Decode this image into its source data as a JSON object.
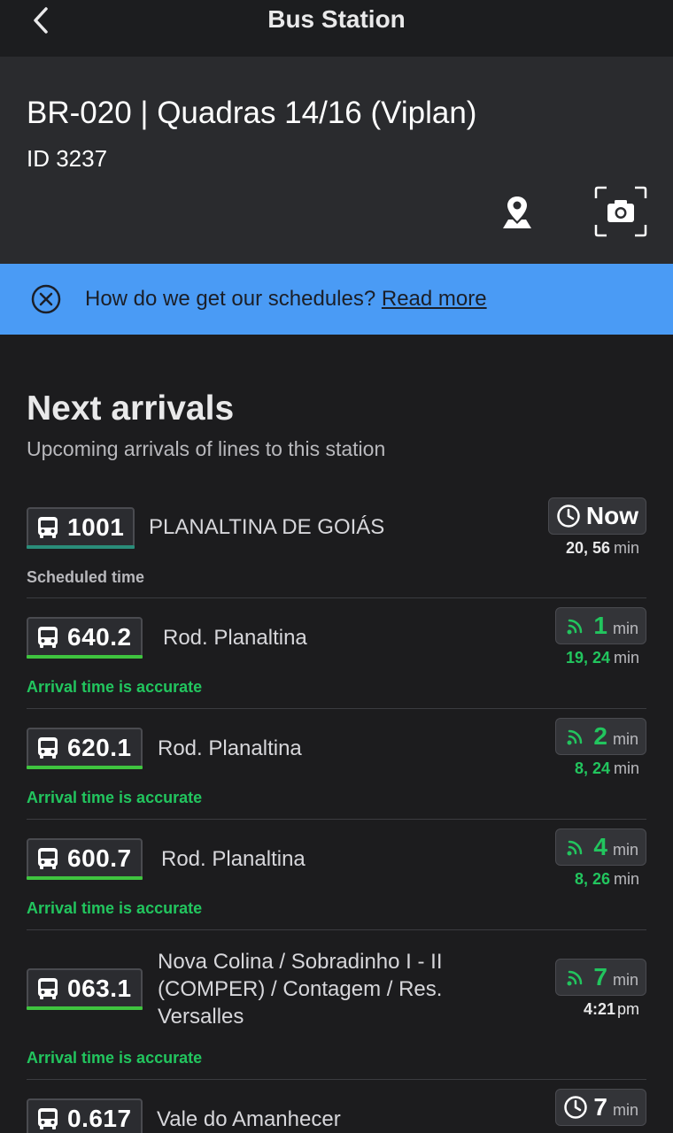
{
  "topbar": {
    "title": "Bus Station",
    "back_icon": "chevron-left-icon"
  },
  "station": {
    "name": "BR-020 | Quadras 14/16 (Viplan)",
    "id_text": "ID 3237",
    "map_icon": "map-pin-icon",
    "camera_icon": "camera-icon"
  },
  "banner": {
    "text": "How do we get our schedules?",
    "link": "Read more",
    "close_icon": "close-circle-icon",
    "color": "#4a9bf5"
  },
  "section": {
    "title": "Next arrivals",
    "subtitle": "Upcoming arrivals of lines to this station"
  },
  "arrivals": [
    {
      "line": "1001",
      "destination": "PLANALTINA DE GOIÁS",
      "eta": "Now",
      "eta_unit": "",
      "eta_icon": "clock-icon",
      "next": "20, 56",
      "next_unit": "min",
      "note": "Scheduled time",
      "realtime": false
    },
    {
      "line": "640.2",
      "destination": "Rod. Planaltina",
      "eta": "1",
      "eta_unit": "min",
      "eta_icon": "realtime-signal-icon",
      "next": "19, 24",
      "next_unit": "min",
      "note": "Arrival time is accurate",
      "realtime": true
    },
    {
      "line": "620.1",
      "destination": "Rod. Planaltina",
      "eta": "2",
      "eta_unit": "min",
      "eta_icon": "realtime-signal-icon",
      "next": "8, 24",
      "next_unit": "min",
      "note": "Arrival time is accurate",
      "realtime": true
    },
    {
      "line": "600.7",
      "destination": "Rod. Planaltina",
      "eta": "4",
      "eta_unit": "min",
      "eta_icon": "realtime-signal-icon",
      "next": "8, 26",
      "next_unit": "min",
      "note": "Arrival time is accurate",
      "realtime": true
    },
    {
      "line": "063.1",
      "destination": "Nova Colina / Sobradinho I - II (COMPER) / Contagem / Res. Versalles",
      "eta": "7",
      "eta_unit": "min",
      "eta_icon": "realtime-signal-icon",
      "next": "4:21",
      "next_unit": "pm",
      "note": "Arrival time is accurate",
      "realtime": true
    },
    {
      "line": "0.617",
      "destination": "Vale do Amanhecer",
      "eta": "7",
      "eta_unit": "min",
      "eta_icon": "clock-icon",
      "realtime": false
    }
  ],
  "colors": {
    "realtime_green": "#22c55e",
    "underline_green": "#3fc43f",
    "underline_teal": "#2a8d7a",
    "background": "#1c1c1e"
  }
}
